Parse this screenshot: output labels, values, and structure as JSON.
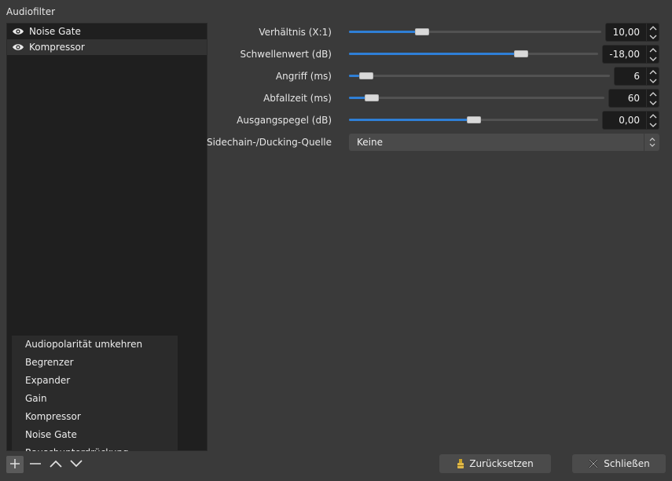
{
  "section": {
    "title": "Audiofilter"
  },
  "filters": [
    {
      "label": "Noise Gate",
      "icon": "eye-icon",
      "selected": false
    },
    {
      "label": "Kompressor",
      "icon": "eye-icon",
      "selected": true
    }
  ],
  "properties": [
    {
      "label": "Verhältnis (X:1)",
      "value": "10,00",
      "fraction": 0.29
    },
    {
      "label": "Schwellenwert (dB)",
      "value": "-18,00",
      "fraction": 0.69
    },
    {
      "label": "Angriff (ms)",
      "value": "6",
      "fraction": 0.04
    },
    {
      "label": "Abfallzeit (ms)",
      "value": "60",
      "fraction": 0.09
    },
    {
      "label": "Ausgangspegel (dB)",
      "value": "0,00",
      "fraction": 0.5
    }
  ],
  "sidechain": {
    "label": "Sidechain-/Ducking-Quelle",
    "value": "Keine"
  },
  "menu": {
    "items": [
      "Audiopolarität umkehren",
      "Begrenzer",
      "Expander",
      "Gain",
      "Kompressor",
      "Noise Gate",
      "Rauschunterdrückung"
    ]
  },
  "toolbar": {
    "add_icon": "plus-icon",
    "remove_icon": "minus-icon",
    "up_icon": "chevron-up-icon",
    "down_icon": "chevron-down-icon"
  },
  "buttons": {
    "reset_label": "Zurücksetzen",
    "reset_icon": "reset-icon",
    "close_label": "Schließen",
    "close_icon": "close-icon"
  },
  "colors": {
    "background": "#3a3a3a",
    "list_background": "#1f1f1f",
    "accent": "#2f7fd6"
  }
}
